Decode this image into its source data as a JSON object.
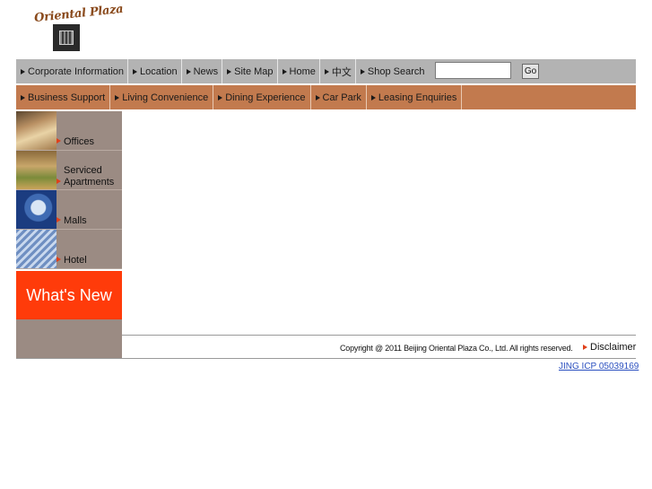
{
  "logo": {
    "text": "Oriental Plaza"
  },
  "top_nav": {
    "items": [
      {
        "label": "Corporate Information"
      },
      {
        "label": "Location"
      },
      {
        "label": "News"
      },
      {
        "label": "Site Map"
      },
      {
        "label": "Home"
      },
      {
        "label": "中文"
      },
      {
        "label": "Shop Search"
      }
    ],
    "search": {
      "value": "",
      "placeholder": ""
    },
    "go_label": "Go"
  },
  "sub_nav": {
    "items": [
      {
        "label": "Business Support"
      },
      {
        "label": "Living Convenience"
      },
      {
        "label": "Dining Experience"
      },
      {
        "label": "Car Park"
      },
      {
        "label": "Leasing Enquiries"
      }
    ]
  },
  "sidebar": {
    "items": [
      {
        "label": "Offices"
      },
      {
        "label_line1": "Serviced",
        "label_line2": "Apartments"
      },
      {
        "label": "Malls"
      },
      {
        "label": "Hotel"
      }
    ],
    "whats_new": "What's New"
  },
  "footer": {
    "copyright": "Copyright @ 2011 Beijing Oriental Plaza Co., Ltd. All rights reserved.",
    "disclaimer": "Disclaimer",
    "icp": "JING ICP 05039169"
  },
  "colors": {
    "top_nav_bg": "#b3b3b3",
    "sub_nav_bg": "#c27a4e",
    "sidebar_bg": "#9b8b83",
    "whats_new_bg": "#ff3b0a",
    "link": "#2a4fbf"
  }
}
